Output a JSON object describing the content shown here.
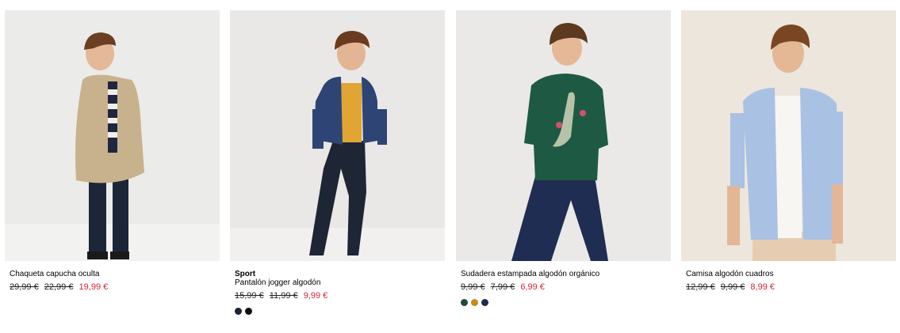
{
  "products": [
    {
      "brand": "",
      "name": "Chaqueta capucha oculta",
      "old_price_1": "29,99 €",
      "old_price_2": "22,99 €",
      "sale_price": "19,99 €",
      "image": "boy-wearing-beige-hooded-jacket",
      "swatches": []
    },
    {
      "brand": "Sport",
      "name": "Pantalón jogger algodón",
      "old_price_1": "15,99 €",
      "old_price_2": "11,99 €",
      "sale_price": "9,99 €",
      "image": "boy-wearing-denim-jacket-and-jogger-pants",
      "swatches": [
        {
          "color": "#1c2333"
        },
        {
          "color": "#111111"
        }
      ]
    },
    {
      "brand": "",
      "name": "Sudadera estampada algodón orgánico",
      "old_price_1": "9,99 €",
      "old_price_2": "7,99 €",
      "sale_price": "6,99 €",
      "image": "boy-wearing-green-dinosaur-sweatshirt",
      "swatches": [
        {
          "color": "#1f4a40"
        },
        {
          "color": "#c58b1d"
        },
        {
          "color": "#1e2d4d"
        }
      ]
    },
    {
      "brand": "",
      "name": "Camisa algodón cuadros",
      "old_price_1": "12,99 €",
      "old_price_2": "9,99 €",
      "sale_price": "8,99 €",
      "image": "boy-wearing-light-blue-shirt",
      "swatches": []
    }
  ],
  "colors": {
    "sale": "#d0243a",
    "text": "#000000",
    "photo_background": "#ececea"
  }
}
